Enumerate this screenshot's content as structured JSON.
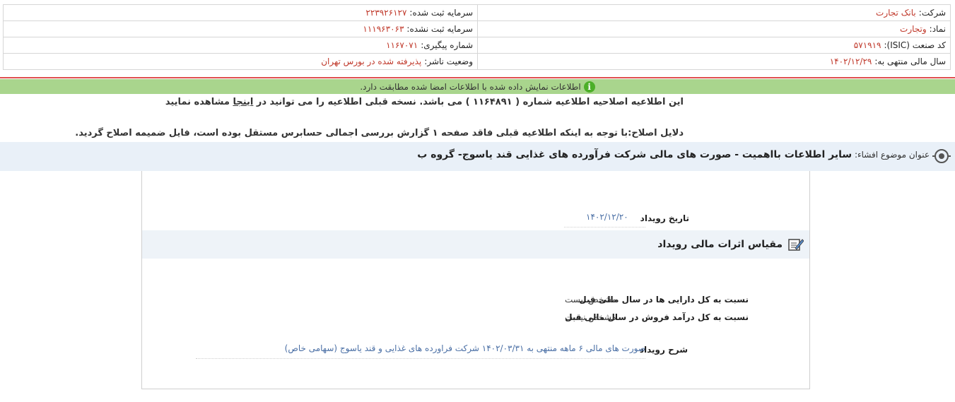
{
  "info": {
    "company_label": "شرکت:",
    "company_value": "بانک تجارت",
    "registered_capital_label": "سرمایه ثبت شده:",
    "registered_capital_value": "۲۲۳۹۲۶۱۲۷",
    "symbol_label": "نماد:",
    "symbol_value": "وتجارت",
    "unregistered_capital_label": "سرمایه ثبت نشده:",
    "unregistered_capital_value": "۱۱۱۹۶۳۰۶۳",
    "isic_label": "کد صنعت (ISIC):",
    "isic_value": "۵۷۱۹۱۹",
    "tracking_label": "شماره پیگیری:",
    "tracking_value": "۱۱۶۷۰۷۱",
    "fiscal_year_label": "سال مالی منتهی به:",
    "fiscal_year_value": "۱۴۰۲/۱۲/۲۹",
    "publisher_status_label": "وضعیت ناشر:",
    "publisher_status_value": "پذیرفته شده در بورس تهران"
  },
  "verification": {
    "icon": "info-icon",
    "text": "اطلاعات نمایش داده شده با اطلاعات امضا شده مطابقت دارد."
  },
  "notice": {
    "line1_before": "این اطلاعیه اصلاحیه اطلاعیه شماره ( ۱۱۶۴۸۹۱ ) می باشد. نسخه قبلی اطلاعیه را می توانید در",
    "link_text": "اینجا",
    "line1_after": "مشاهده نمایید",
    "line2": "دلایل اصلاح:با توجه به اینکه اطلاعیه قبلی فاقد صفحه ۱ گزارش بررسی اجمالی حسابرس مستقل بوده است، فایل ضمیمه اصلاح گردید."
  },
  "subject": {
    "label": "عنوان موضوع افشاء:",
    "title": "سایر اطلاعات بااهمیت - صورت های مالی شرکت فرآورده های غذایی قند یاسوج- گروه ب"
  },
  "event": {
    "date_label": "تاریخ رویداد",
    "date_value": "۱۴۰۲/۱۲/۲۰",
    "section_title": "مقیاس اثرات مالی رویداد",
    "assets_label": "نسبت به کل دارایی ها در سال مالی قبل",
    "assets_value": "مشخص نیست",
    "revenue_label": "نسبت به کل درآمد فروش در سال مالی قبل",
    "revenue_value": "مشخص نیست",
    "description_label": "شرح رویداد",
    "description_value": "صورت های مالی ۶ ماهه منتهی به ۱۴۰۲/۰۳/۳۱ شرکت فراورده های غذایی و قند یاسوج (سهامی خاص)"
  }
}
